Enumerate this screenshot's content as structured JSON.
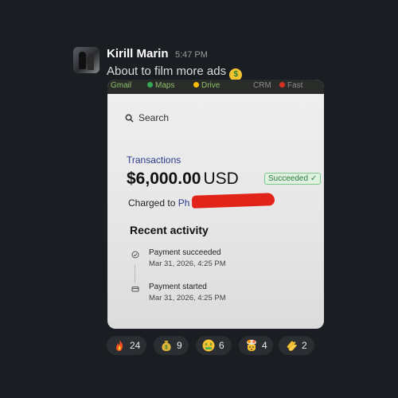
{
  "message": {
    "author": "Kirill Marin",
    "time": "5:47 PM",
    "text": "About to film more ads",
    "text_emoji": "money-mouth-face"
  },
  "screenshot": {
    "bookmarks": [
      "Gmail",
      "Maps",
      "Drive",
      "CRM",
      "Fast"
    ],
    "search_placeholder": "Search",
    "transactions_label": "Transactions",
    "amount": "$6,000.00",
    "currency": "USD",
    "status_badge": "Succeeded ✓",
    "charged_prefix": "Charged to",
    "charged_name": "Ph",
    "recent_activity_title": "Recent activity",
    "activity": [
      {
        "title": "Payment succeeded",
        "date": "Mar 31, 2026, 4:25 PM",
        "icon": "check-circle-icon"
      },
      {
        "title": "Payment started",
        "date": "Mar 31, 2026, 4:25 PM",
        "icon": "card-icon"
      }
    ]
  },
  "reactions": [
    {
      "emoji": "fire",
      "count": "24"
    },
    {
      "emoji": "money-bag",
      "count": "9"
    },
    {
      "emoji": "money-mouth-face",
      "count": "6"
    },
    {
      "emoji": "exploding-head",
      "count": "4"
    },
    {
      "emoji": "clapping-hands",
      "count": "2"
    }
  ],
  "colors": {
    "background": "#1a1d21",
    "link": "#2b3a8c",
    "success": "#2f7a3e",
    "redaction": "#e2231a"
  }
}
